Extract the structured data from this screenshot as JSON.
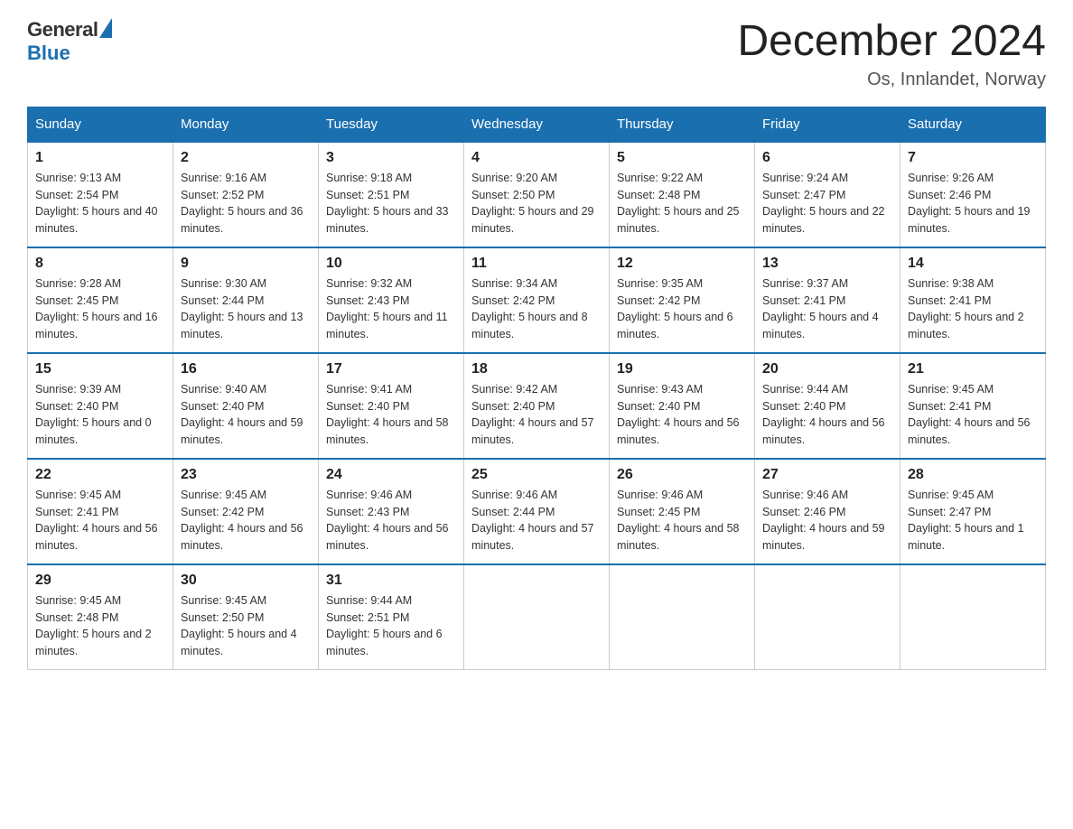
{
  "header": {
    "logo_general": "General",
    "logo_blue": "Blue",
    "month_title": "December 2024",
    "location": "Os, Innlandet, Norway"
  },
  "days_of_week": [
    "Sunday",
    "Monday",
    "Tuesday",
    "Wednesday",
    "Thursday",
    "Friday",
    "Saturday"
  ],
  "weeks": [
    [
      {
        "num": "1",
        "sunrise": "9:13 AM",
        "sunset": "2:54 PM",
        "daylight": "5 hours and 40 minutes."
      },
      {
        "num": "2",
        "sunrise": "9:16 AM",
        "sunset": "2:52 PM",
        "daylight": "5 hours and 36 minutes."
      },
      {
        "num": "3",
        "sunrise": "9:18 AM",
        "sunset": "2:51 PM",
        "daylight": "5 hours and 33 minutes."
      },
      {
        "num": "4",
        "sunrise": "9:20 AM",
        "sunset": "2:50 PM",
        "daylight": "5 hours and 29 minutes."
      },
      {
        "num": "5",
        "sunrise": "9:22 AM",
        "sunset": "2:48 PM",
        "daylight": "5 hours and 25 minutes."
      },
      {
        "num": "6",
        "sunrise": "9:24 AM",
        "sunset": "2:47 PM",
        "daylight": "5 hours and 22 minutes."
      },
      {
        "num": "7",
        "sunrise": "9:26 AM",
        "sunset": "2:46 PM",
        "daylight": "5 hours and 19 minutes."
      }
    ],
    [
      {
        "num": "8",
        "sunrise": "9:28 AM",
        "sunset": "2:45 PM",
        "daylight": "5 hours and 16 minutes."
      },
      {
        "num": "9",
        "sunrise": "9:30 AM",
        "sunset": "2:44 PM",
        "daylight": "5 hours and 13 minutes."
      },
      {
        "num": "10",
        "sunrise": "9:32 AM",
        "sunset": "2:43 PM",
        "daylight": "5 hours and 11 minutes."
      },
      {
        "num": "11",
        "sunrise": "9:34 AM",
        "sunset": "2:42 PM",
        "daylight": "5 hours and 8 minutes."
      },
      {
        "num": "12",
        "sunrise": "9:35 AM",
        "sunset": "2:42 PM",
        "daylight": "5 hours and 6 minutes."
      },
      {
        "num": "13",
        "sunrise": "9:37 AM",
        "sunset": "2:41 PM",
        "daylight": "5 hours and 4 minutes."
      },
      {
        "num": "14",
        "sunrise": "9:38 AM",
        "sunset": "2:41 PM",
        "daylight": "5 hours and 2 minutes."
      }
    ],
    [
      {
        "num": "15",
        "sunrise": "9:39 AM",
        "sunset": "2:40 PM",
        "daylight": "5 hours and 0 minutes."
      },
      {
        "num": "16",
        "sunrise": "9:40 AM",
        "sunset": "2:40 PM",
        "daylight": "4 hours and 59 minutes."
      },
      {
        "num": "17",
        "sunrise": "9:41 AM",
        "sunset": "2:40 PM",
        "daylight": "4 hours and 58 minutes."
      },
      {
        "num": "18",
        "sunrise": "9:42 AM",
        "sunset": "2:40 PM",
        "daylight": "4 hours and 57 minutes."
      },
      {
        "num": "19",
        "sunrise": "9:43 AM",
        "sunset": "2:40 PM",
        "daylight": "4 hours and 56 minutes."
      },
      {
        "num": "20",
        "sunrise": "9:44 AM",
        "sunset": "2:40 PM",
        "daylight": "4 hours and 56 minutes."
      },
      {
        "num": "21",
        "sunrise": "9:45 AM",
        "sunset": "2:41 PM",
        "daylight": "4 hours and 56 minutes."
      }
    ],
    [
      {
        "num": "22",
        "sunrise": "9:45 AM",
        "sunset": "2:41 PM",
        "daylight": "4 hours and 56 minutes."
      },
      {
        "num": "23",
        "sunrise": "9:45 AM",
        "sunset": "2:42 PM",
        "daylight": "4 hours and 56 minutes."
      },
      {
        "num": "24",
        "sunrise": "9:46 AM",
        "sunset": "2:43 PM",
        "daylight": "4 hours and 56 minutes."
      },
      {
        "num": "25",
        "sunrise": "9:46 AM",
        "sunset": "2:44 PM",
        "daylight": "4 hours and 57 minutes."
      },
      {
        "num": "26",
        "sunrise": "9:46 AM",
        "sunset": "2:45 PM",
        "daylight": "4 hours and 58 minutes."
      },
      {
        "num": "27",
        "sunrise": "9:46 AM",
        "sunset": "2:46 PM",
        "daylight": "4 hours and 59 minutes."
      },
      {
        "num": "28",
        "sunrise": "9:45 AM",
        "sunset": "2:47 PM",
        "daylight": "5 hours and 1 minute."
      }
    ],
    [
      {
        "num": "29",
        "sunrise": "9:45 AM",
        "sunset": "2:48 PM",
        "daylight": "5 hours and 2 minutes."
      },
      {
        "num": "30",
        "sunrise": "9:45 AM",
        "sunset": "2:50 PM",
        "daylight": "5 hours and 4 minutes."
      },
      {
        "num": "31",
        "sunrise": "9:44 AM",
        "sunset": "2:51 PM",
        "daylight": "5 hours and 6 minutes."
      },
      null,
      null,
      null,
      null
    ]
  ],
  "labels": {
    "sunrise": "Sunrise: ",
    "sunset": "Sunset: ",
    "daylight": "Daylight: "
  }
}
